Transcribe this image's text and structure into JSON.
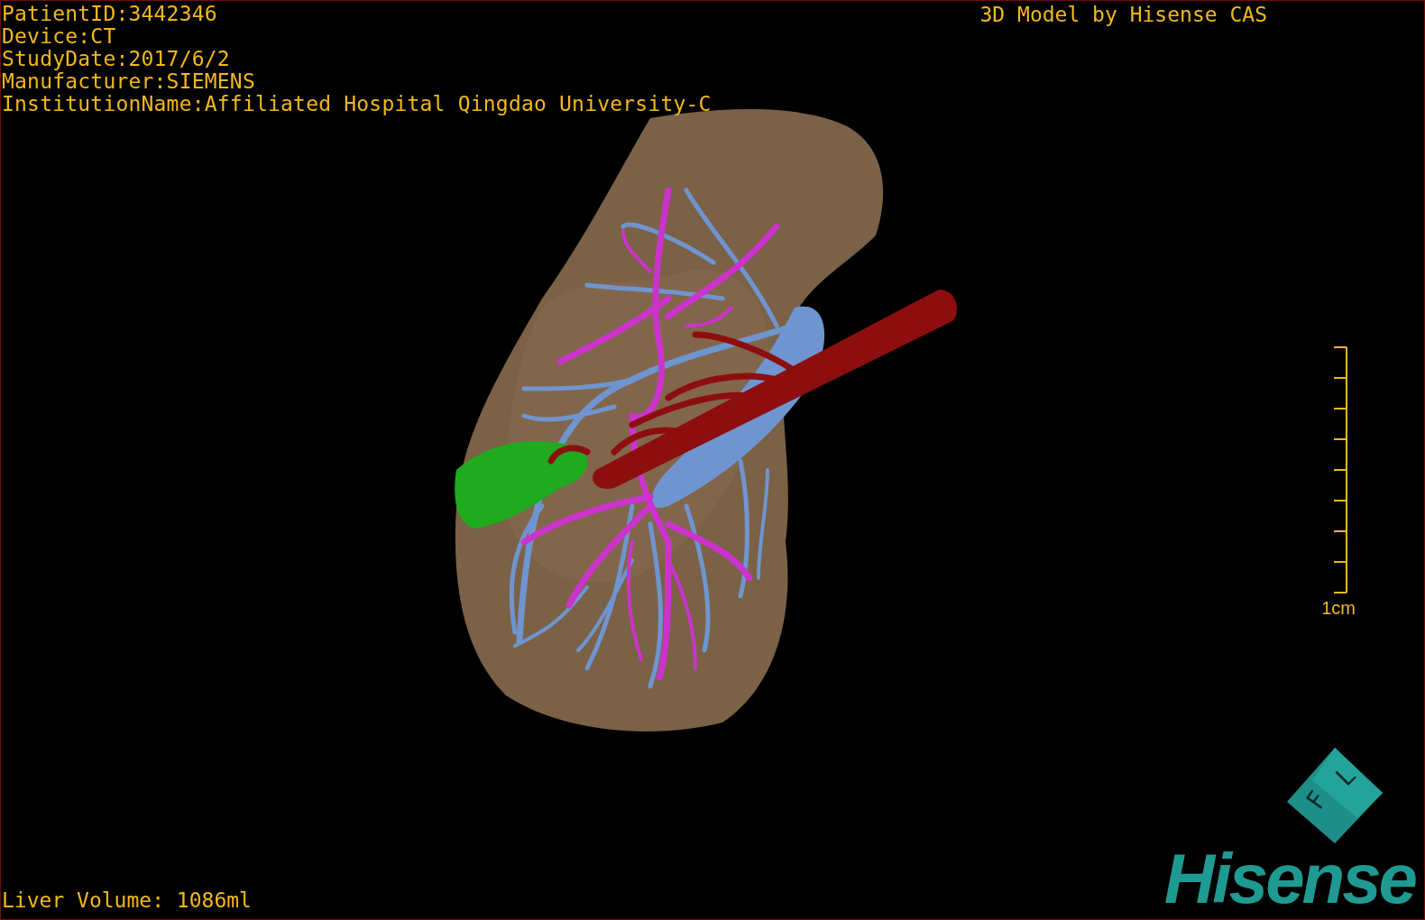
{
  "patient_info": [
    "PatientID:3442346",
    "Device:CT",
    "StudyDate:2017/6/2",
    "Manufacturer:SIEMENS",
    "InstitutionName:Affiliated Hospital Qingdao University-C"
  ],
  "title": "3D Model by Hisense CAS",
  "scale_bar": {
    "label": "1cm"
  },
  "orientation_cube": {
    "faces": [
      "F",
      "L"
    ]
  },
  "logo": "Hisense",
  "liver_volume": "Liver Volume: 1086ml"
}
